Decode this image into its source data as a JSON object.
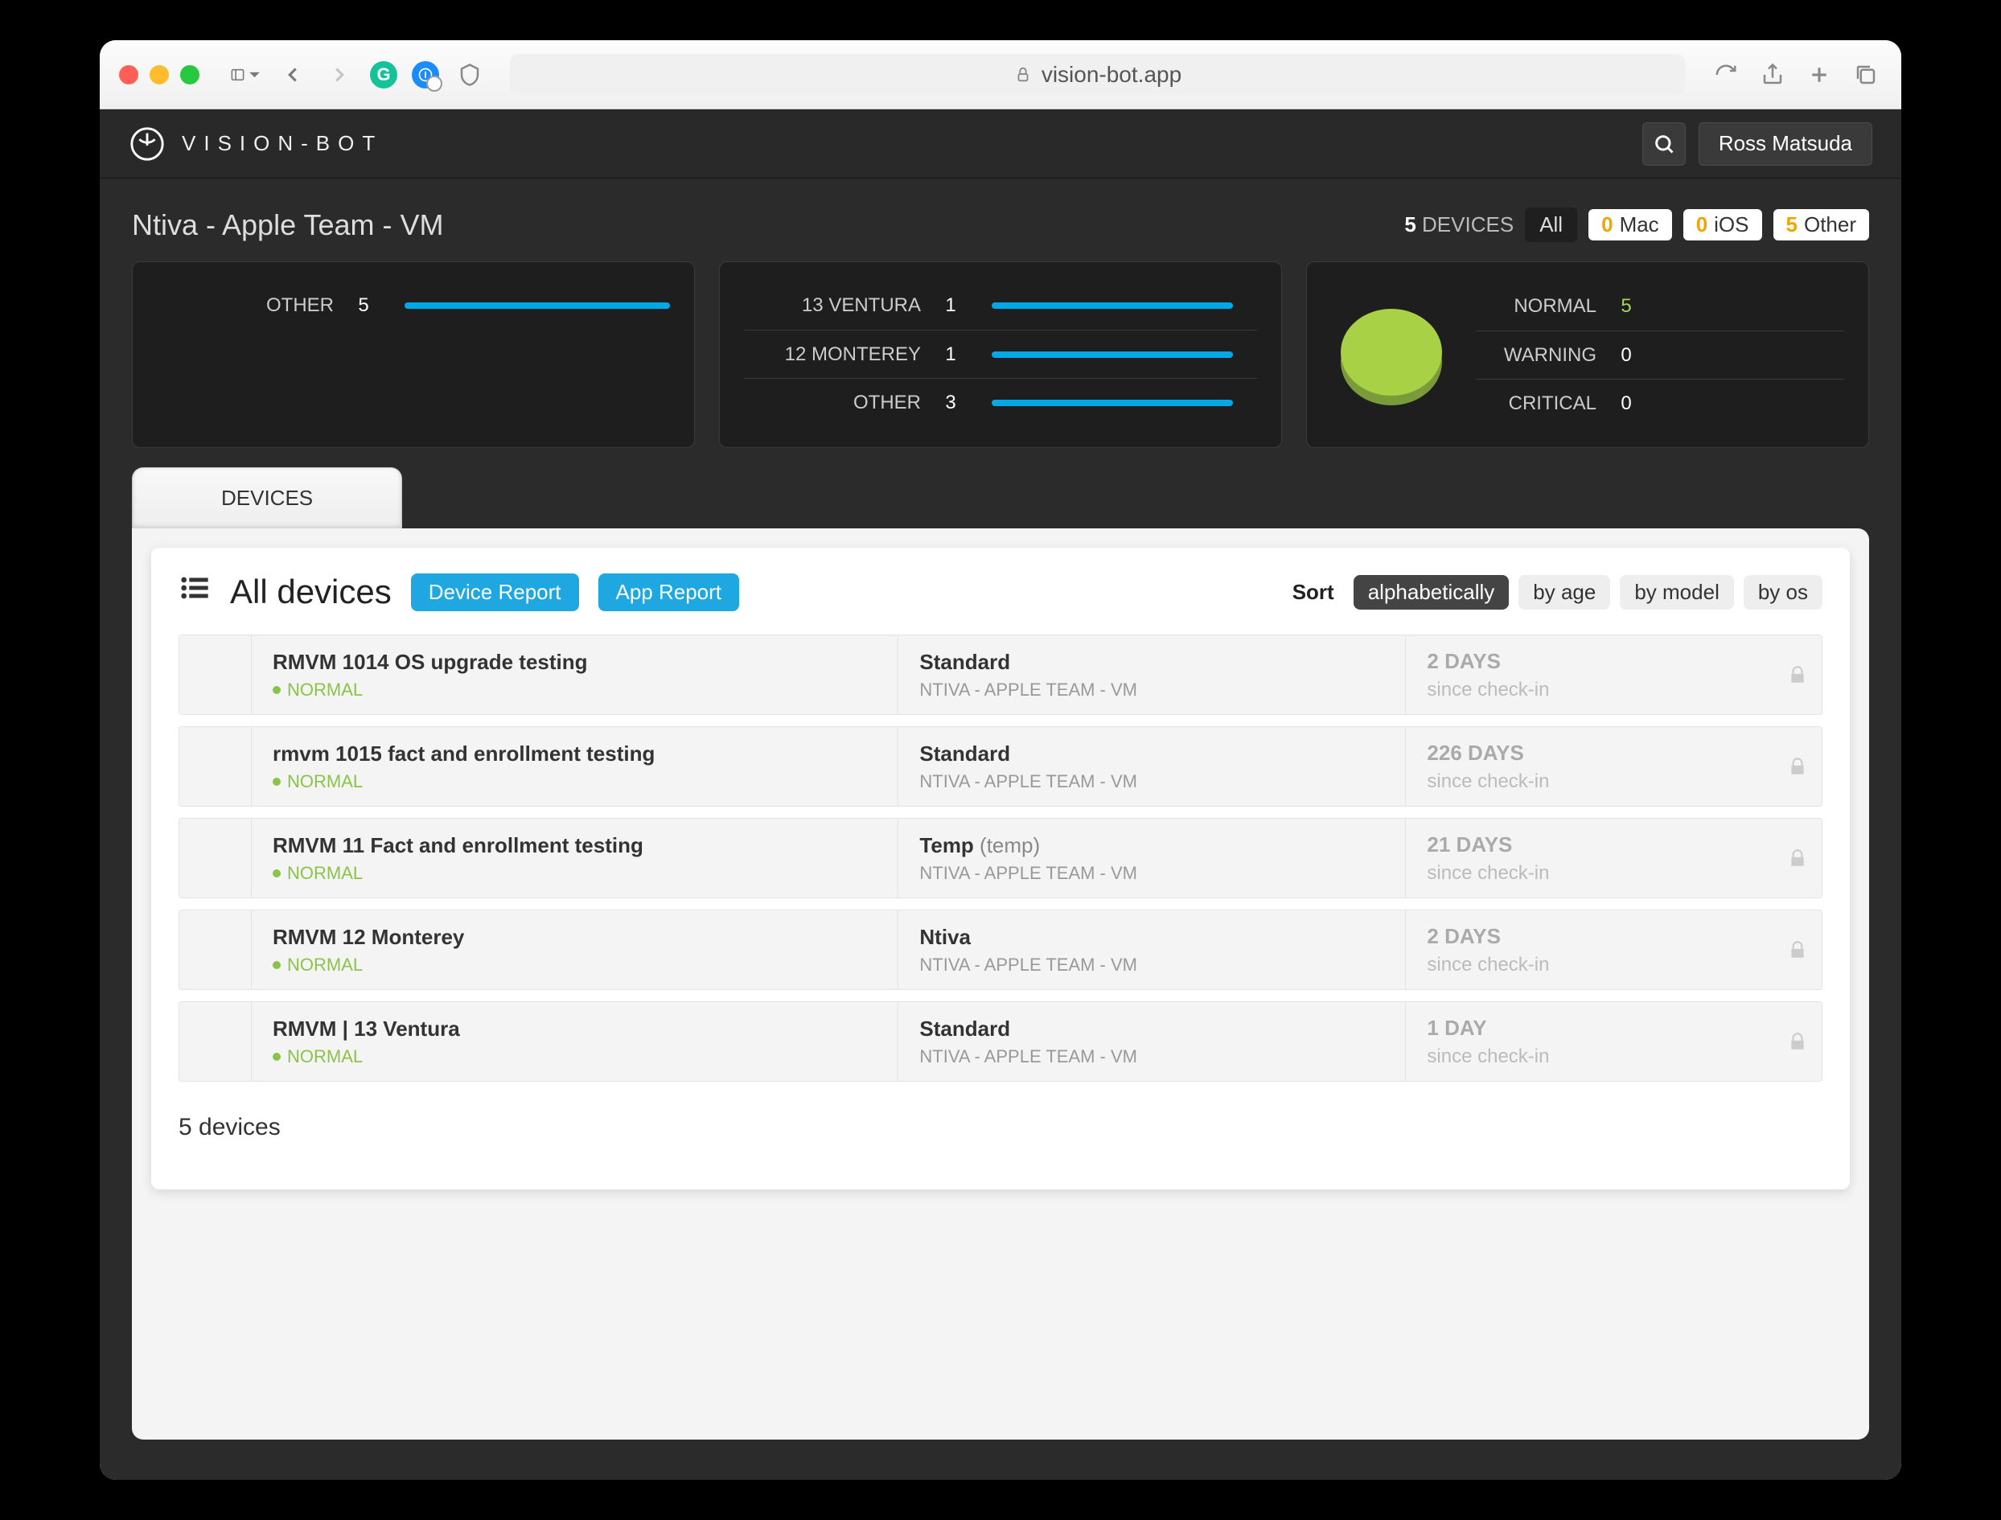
{
  "browser": {
    "url_host": "vision-bot.app"
  },
  "brand": "VISION-BOT",
  "user_name": "Ross Matsuda",
  "breadcrumb": "Ntiva - Apple Team - VM",
  "device_count": "5",
  "device_count_label": "DEVICES",
  "filters": {
    "all": "All",
    "mac": {
      "n": "0",
      "label": "Mac"
    },
    "ios": {
      "n": "0",
      "label": "iOS"
    },
    "other": {
      "n": "5",
      "label": "Other"
    }
  },
  "card_other": {
    "label": "OTHER",
    "value": "5"
  },
  "card_os": {
    "rows": [
      {
        "label": "13 VENTURA",
        "value": "1"
      },
      {
        "label": "12 MONTEREY",
        "value": "1"
      },
      {
        "label": "OTHER",
        "value": "3"
      }
    ]
  },
  "card_status": {
    "rows": [
      {
        "label": "NORMAL",
        "value": "5",
        "good": true
      },
      {
        "label": "WARNING",
        "value": "0"
      },
      {
        "label": "CRITICAL",
        "value": "0"
      }
    ]
  },
  "tab_label": "DEVICES",
  "title": "All devices",
  "buttons": {
    "device_report": "Device Report",
    "app_report": "App Report"
  },
  "sort": {
    "label": "Sort",
    "options": [
      "alphabetically",
      "by age",
      "by model",
      "by os"
    ],
    "active": "alphabetically"
  },
  "devices": [
    {
      "name": "RMVM 1014 OS upgrade testing",
      "status": "NORMAL",
      "owner": "Standard",
      "owner_extra": "",
      "team": "NTIVA - APPLE TEAM - VM",
      "days": "2 DAYS",
      "since": "since check-in"
    },
    {
      "name": "rmvm 1015 fact and enrollment testing",
      "status": "NORMAL",
      "owner": "Standard",
      "owner_extra": "",
      "team": "NTIVA - APPLE TEAM - VM",
      "days": "226 DAYS",
      "since": "since check-in"
    },
    {
      "name": "RMVM 11 Fact and enrollment testing",
      "status": "NORMAL",
      "owner": "Temp",
      "owner_extra": " (temp)",
      "team": "NTIVA - APPLE TEAM - VM",
      "days": "21 DAYS",
      "since": "since check-in"
    },
    {
      "name": "RMVM 12 Monterey",
      "status": "NORMAL",
      "owner": "Ntiva",
      "owner_extra": "",
      "team": "NTIVA - APPLE TEAM - VM",
      "days": "2 DAYS",
      "since": "since check-in"
    },
    {
      "name": "RMVM | 13 Ventura",
      "status": "NORMAL",
      "owner": "Standard",
      "owner_extra": "",
      "team": "NTIVA - APPLE TEAM - VM",
      "days": "1 DAY",
      "since": "since check-in"
    }
  ],
  "footer_count": "5 devices",
  "chart_data": [
    {
      "type": "bar",
      "title": "Device platform",
      "categories": [
        "OTHER"
      ],
      "values": [
        5
      ]
    },
    {
      "type": "bar",
      "title": "macOS version",
      "categories": [
        "13 VENTURA",
        "12 MONTEREY",
        "OTHER"
      ],
      "values": [
        1,
        1,
        3
      ]
    },
    {
      "type": "pie",
      "title": "Device health",
      "categories": [
        "NORMAL",
        "WARNING",
        "CRITICAL"
      ],
      "values": [
        5,
        0,
        0
      ]
    }
  ]
}
